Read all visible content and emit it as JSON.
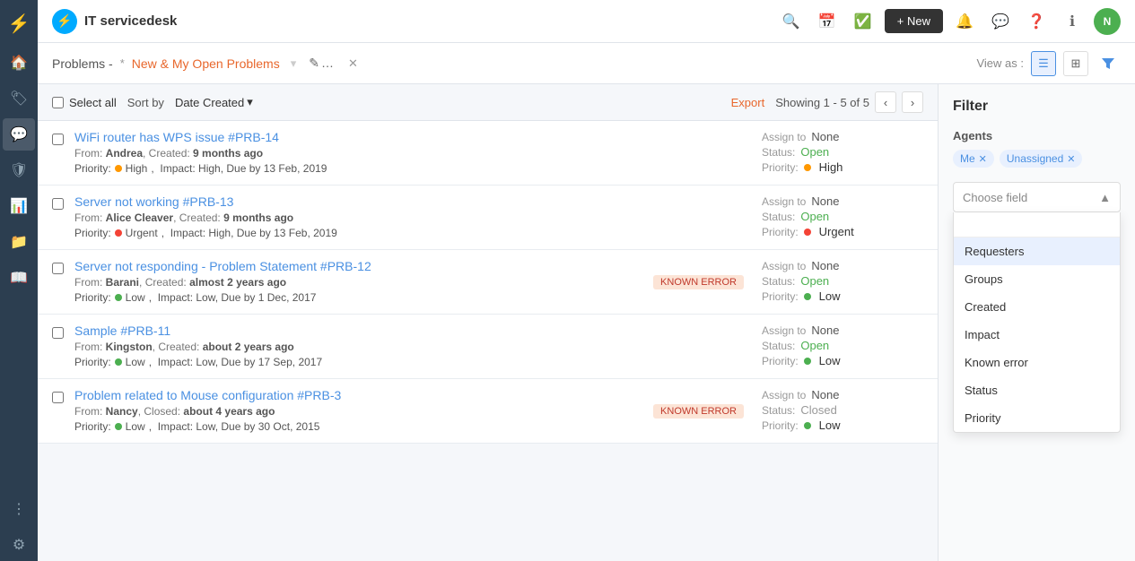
{
  "app": {
    "name": "IT servicedesk",
    "logo_icon": "⚡"
  },
  "topbar": {
    "new_button": "+ New",
    "avatar_initials": "N"
  },
  "breadcrumb": {
    "static": "Problems -",
    "separator": "*",
    "link": "New & My Open Problems",
    "edit_icon": "✎",
    "close_icon": "✕"
  },
  "subheader": {
    "view_as_label": "View as :",
    "filter_icon": "⊟"
  },
  "list_toolbar": {
    "select_all": "Select all",
    "sort_by": "Sort by",
    "sort_field": "Date Created",
    "export": "Export",
    "showing": "Showing 1 - 5 of 5"
  },
  "problems": [
    {
      "id": "PRB-14",
      "title": "WiFi router has WPS issue",
      "tag": "#PRB-14",
      "from": "Andrea",
      "created": "9 months ago",
      "priority_label": "High",
      "priority_type": "high",
      "impact_label": "High",
      "due": "13 Feb, 2019",
      "assign_to": "None",
      "status": "Open",
      "priority_display": "High",
      "badge": null,
      "closed": false
    },
    {
      "id": "PRB-13",
      "title": "Server not working",
      "tag": "#PRB-13",
      "from": "Alice Cleaver",
      "created": "9 months ago",
      "priority_label": "Urgent",
      "priority_type": "urgent",
      "impact_label": "High",
      "due": "13 Feb, 2019",
      "assign_to": "None",
      "status": "Open",
      "priority_display": "Urgent",
      "badge": null,
      "closed": false
    },
    {
      "id": "PRB-12",
      "title": "Server not responding - Problem Statement",
      "tag": "#PRB-12",
      "from": "Barani",
      "created": "almost 2 years ago",
      "priority_label": "Low",
      "priority_type": "low",
      "impact_label": "Low",
      "due": "1 Dec, 2017",
      "assign_to": "None",
      "status": "Open",
      "priority_display": "Low",
      "badge": "KNOWN ERROR",
      "badge_type": "known-error",
      "closed": false
    },
    {
      "id": "PRB-11",
      "title": "Sample",
      "tag": "#PRB-11",
      "from": "Kingston",
      "created": "about 2 years ago",
      "priority_label": "Low",
      "priority_type": "low",
      "impact_label": "Low",
      "due": "17 Sep, 2017",
      "assign_to": "None",
      "status": "Open",
      "priority_display": "Low",
      "badge": null,
      "closed": false
    },
    {
      "id": "PRB-3",
      "title": "Problem related to Mouse configuration",
      "tag": "#PRB-3",
      "from": "Nancy",
      "created": "about 4 years ago",
      "priority_label": "Low",
      "priority_type": "low",
      "impact_label": "Low",
      "due": "30 Oct, 2015",
      "assign_to": "None",
      "status": "Closed",
      "priority_display": "Low",
      "badge": "KNOWN ERROR",
      "badge_type": "known-error",
      "closed": true
    }
  ],
  "filter": {
    "title": "Filter",
    "agents_label": "Agents",
    "tags": [
      {
        "label": "Me",
        "id": "me"
      },
      {
        "label": "Unassigned",
        "id": "unassigned"
      }
    ],
    "choose_field_placeholder": "Choose field",
    "dropdown_items": [
      {
        "label": "Requesters",
        "highlighted": true
      },
      {
        "label": "Groups",
        "highlighted": false
      },
      {
        "label": "Created",
        "highlighted": false
      },
      {
        "label": "Impact",
        "highlighted": false
      },
      {
        "label": "Known error",
        "highlighted": false
      },
      {
        "label": "Status",
        "highlighted": false
      },
      {
        "label": "Priority",
        "highlighted": false
      }
    ]
  },
  "sidebar_icons": [
    "🏠",
    "🏷",
    "💬",
    "🛡",
    "📊",
    "📁",
    "📖",
    "⚙"
  ]
}
